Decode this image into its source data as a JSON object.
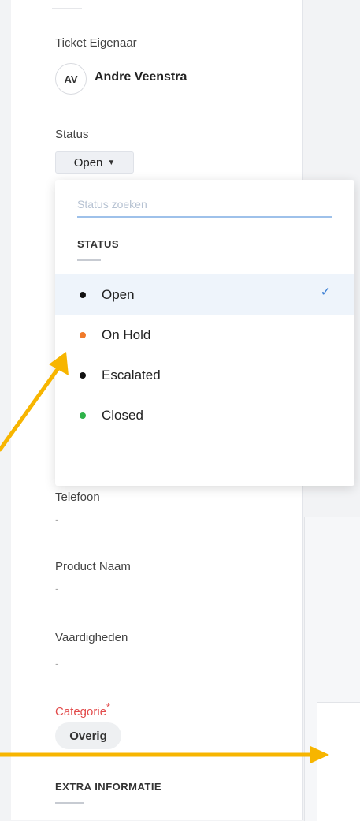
{
  "owner": {
    "label": "Ticket Eigenaar",
    "initials": "AV",
    "name": "Andre Veenstra"
  },
  "status": {
    "label": "Status",
    "value": "Open"
  },
  "dropdown": {
    "search_placeholder": "Status zoeken",
    "section_title": "STATUS",
    "options": [
      {
        "label": "Open",
        "color": "#111111",
        "selected": true
      },
      {
        "label": "On Hold",
        "color": "#f07a2a",
        "selected": false
      },
      {
        "label": "Escalated",
        "color": "#111111",
        "selected": false
      },
      {
        "label": "Closed",
        "color": "#2fb34a",
        "selected": false
      }
    ],
    "check_icon": "checkmark-icon"
  },
  "fields": {
    "telefoon": {
      "label": "Telefoon",
      "value": "-"
    },
    "product_naam": {
      "label": "Product Naam",
      "value": "-"
    },
    "vaardigheden": {
      "label": "Vaardigheden",
      "value": "-"
    },
    "categorie": {
      "label": "Categorie",
      "required_mark": "*",
      "value": "Overig"
    }
  },
  "extra_section_title": "EXTRA INFORMATIE",
  "annotation_color": "#f7b500"
}
